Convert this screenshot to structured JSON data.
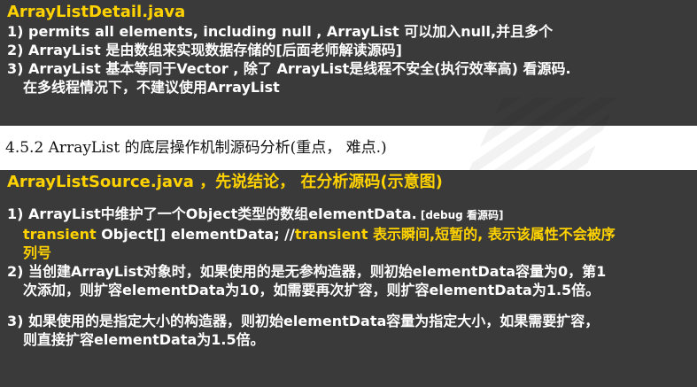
{
  "top_panel": {
    "title": "ArrayListDetail.java",
    "lines": [
      "1) permits all elements, including null , ArrayList 可以加入null,并且多个",
      "2) ArrayList 是由数组来实现数据存储的[后面老师解读源码]",
      "3) ArrayList 基本等同于Vector , 除了 ArrayList是线程不安全(执行效率高) 看源码.",
      "在多线程情况下，不建议使用ArrayList"
    ]
  },
  "heading": "4.5.2  ArrayList 的底层操作机制源码分析(重点， 难点.)",
  "bottom_panel": {
    "title": "ArrayListSource.java ，先说结论， 在分析源码(示意图)",
    "item1_text": "1) ArrayList中维护了一个Object类型的数组elementData.",
    "item1_note": " [debug 看源码]",
    "item1_code": "transient",
    "item1_code_rest": " Object[] elementData; //",
    "item1_comment": "transient  表示瞬间,短暂的, 表示该属性不会被序",
    "item1_comment_cont": "列号",
    "item2_line1": "2) 当创建ArrayList对象时，如果使用的是无参构造器，则初始elementData容量为0，第1",
    "item2_line2": "次添加，则扩容elementData为10，如需要再次扩容，则扩容elementData为1.5倍。",
    "item3_line1": "3) 如果使用的是指定大小的构造器，则初始elementData容量为指定大小，如果需要扩容，",
    "item3_line2": "则直接扩容elementData为1.5倍。"
  },
  "colors": {
    "panel_bg": "#3a3a3a",
    "highlight": "#ffd200",
    "text": "#ffffff"
  }
}
